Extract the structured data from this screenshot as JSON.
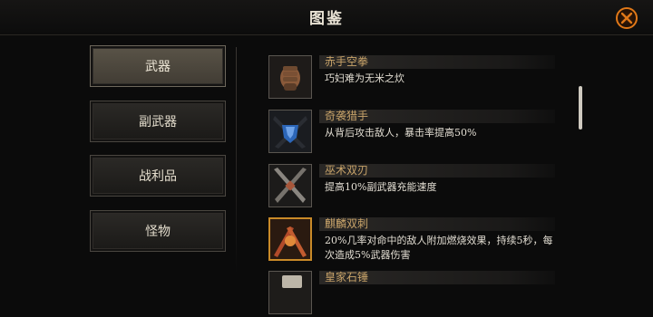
{
  "header": {
    "title": "图鉴"
  },
  "categories": [
    {
      "label": "武器",
      "active": true
    },
    {
      "label": "副武器",
      "active": false
    },
    {
      "label": "战利品",
      "active": false
    },
    {
      "label": "怪物",
      "active": false
    }
  ],
  "items": [
    {
      "name": "赤手空拳",
      "desc": "巧妇难为无米之炊",
      "icon": "fist-icon"
    },
    {
      "name": "奇袭猎手",
      "desc": "从背后攻击敌人，暴击率提高50%",
      "icon": "gauntlet-icon"
    },
    {
      "name": "巫术双刃",
      "desc": "提高10%副武器充能速度",
      "icon": "twin-blades-icon"
    },
    {
      "name": "麒麟双刺",
      "desc": "20%几率对命中的敌人附加燃烧效果，持续5秒，每次造成5%武器伤害",
      "icon": "qilin-daggers-icon"
    },
    {
      "name": "皇家石锤",
      "desc": "",
      "icon": "stone-hammer-icon"
    }
  ],
  "colors": {
    "accent": "#e07818",
    "item_name": "#c9a46a",
    "rare_border": "#c98a28"
  }
}
